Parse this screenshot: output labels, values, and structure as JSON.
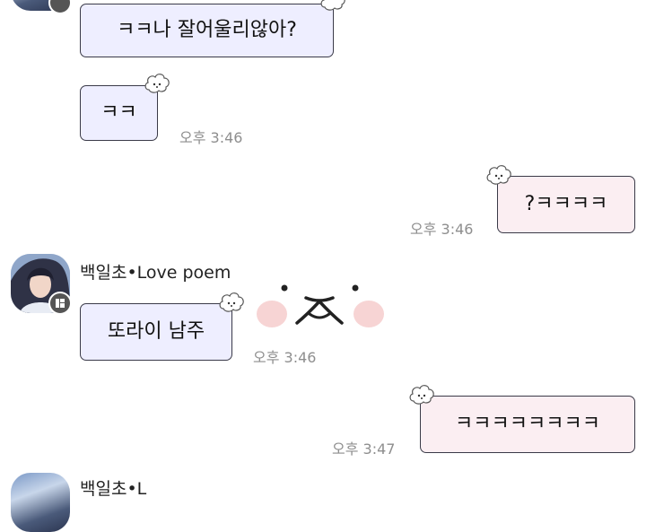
{
  "messages": [
    {
      "side": "in",
      "text": "ㅋㅋ나 잘어울리않아?"
    },
    {
      "side": "in",
      "text": "ㅋㅋ",
      "time": "오후 3:46"
    },
    {
      "side": "out",
      "text": "?ㅋㅋㅋㅋ",
      "time": "오후 3:46"
    },
    {
      "side": "in",
      "sender": "백일초•Love poem",
      "text": "또라이 남주",
      "time": "오후 3:46",
      "sticker": "white-seal-face-emoticon"
    },
    {
      "side": "out",
      "text": "ㅋㅋㅋㅋㅋㅋㅋㅋ",
      "time": "오후 3:47"
    },
    {
      "side": "in",
      "sender": "백일초•L"
    }
  ],
  "colors": {
    "incoming_bubble": "#eeeeff",
    "outgoing_bubble": "#fbeef2",
    "bubble_border": "#3a3a48",
    "timestamp": "#8e8e8e",
    "sticker_cheek": "#f7d4d4"
  },
  "icons": {
    "bubble_decoration": "cloud-puppy-icon",
    "avatar_badge": "profile-badge-icon"
  }
}
